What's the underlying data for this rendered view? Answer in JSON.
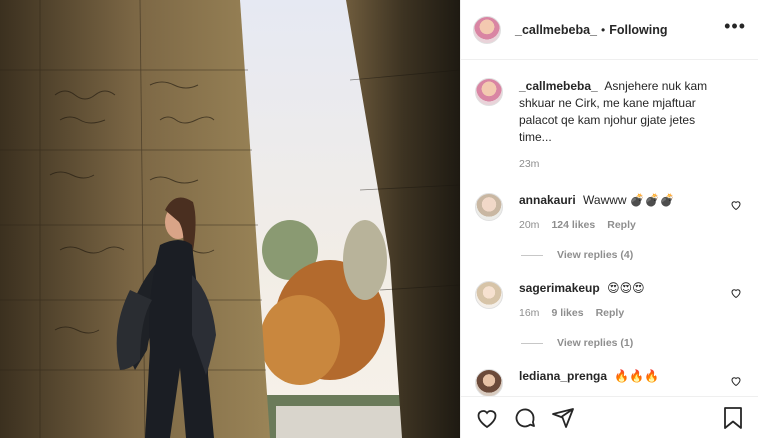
{
  "post": {
    "author": "_callmebeba_",
    "separator": "•",
    "follow_label": "Following",
    "more_label": "•••",
    "caption": "Asnjehere nuk kam shkuar ne Cirk, me kane mjaftuar palacot qe kam njohur gjate jetes time...",
    "caption_time": "23m"
  },
  "comments": [
    {
      "user": "annakauri",
      "text": "Wawww 💣💣💣",
      "time": "20m",
      "likes": "124 likes",
      "reply_label": "Reply",
      "view_replies": "View replies (4)"
    },
    {
      "user": "sagerimakeup",
      "text": "😍😍😍",
      "time": "16m",
      "likes": "9 likes",
      "reply_label": "Reply",
      "view_replies": "View replies (1)"
    },
    {
      "user": "lediana_prenga",
      "text": "🔥🔥🔥"
    }
  ],
  "icons": {
    "like": "heart-icon",
    "comment": "comment-icon",
    "share": "paper-plane-icon",
    "save": "bookmark-icon"
  }
}
